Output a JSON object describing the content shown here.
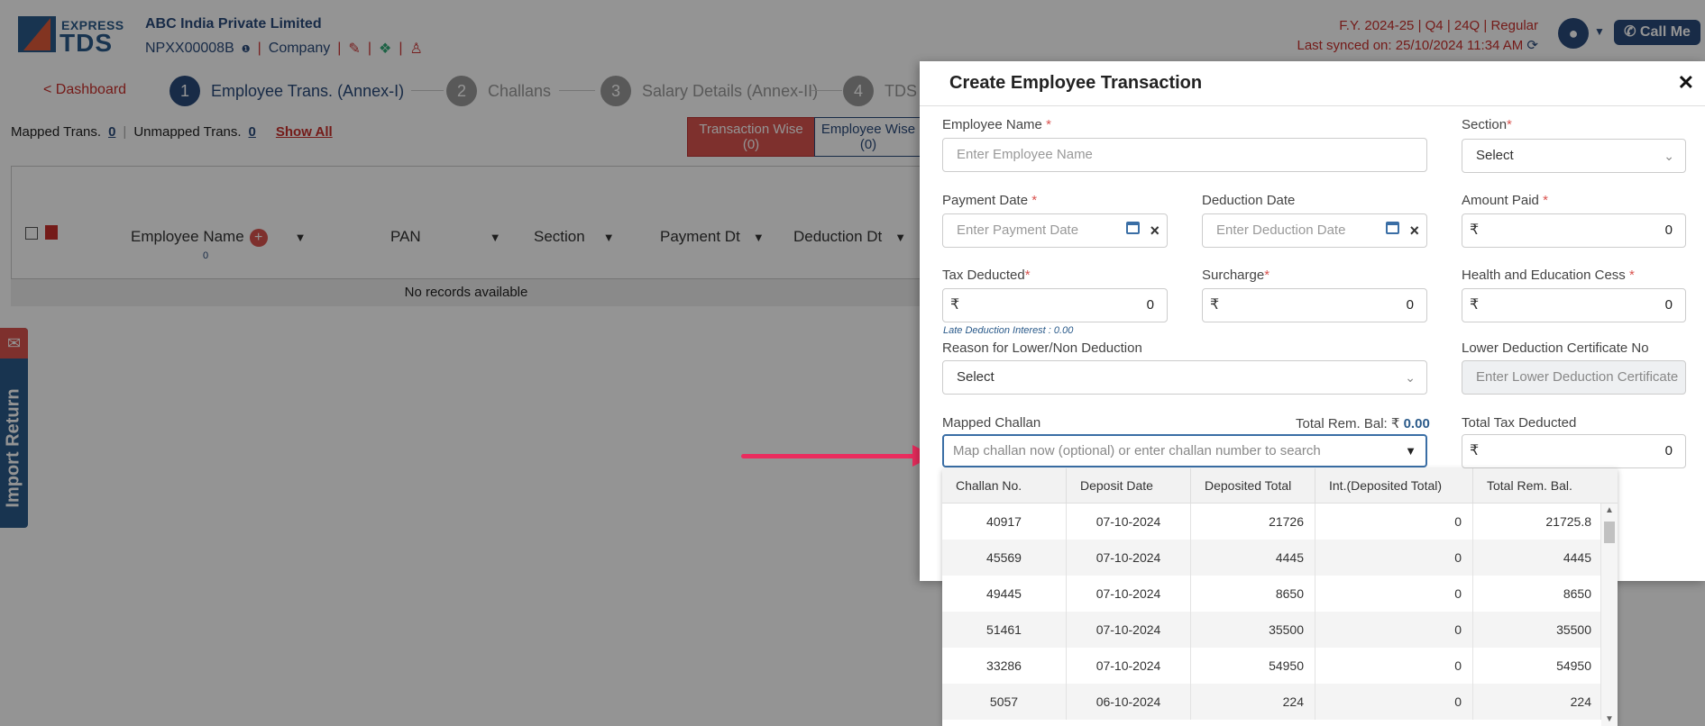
{
  "header": {
    "logo_top": "EXPRESS",
    "logo_bottom": "TDS",
    "company_name": "ABC India Private Limited",
    "tan": "NPXX00008B",
    "company_type": "Company",
    "fy_line": "F.Y. 2024-25  | Q4  | 24Q | Regular",
    "synced": "Last synced on: 25/10/2024 11:34 AM",
    "call_me": "Call Me"
  },
  "steps": {
    "back": "< Dashboard",
    "items": [
      {
        "num": "1",
        "label": "Employee Trans. (Annex-I)"
      },
      {
        "num": "2",
        "label": "Challans"
      },
      {
        "num": "3",
        "label": "Salary Details (Annex-II)"
      },
      {
        "num": "4",
        "label": "TDS"
      }
    ]
  },
  "toolbar": {
    "mapped_label": "Mapped Trans.",
    "mapped_count": "0",
    "unmapped_label": "Unmapped Trans.",
    "unmapped_count": "0",
    "show_all": "Show All",
    "transaction_wise": "Transaction Wise",
    "transaction_wise_count": "(0)",
    "employee_wise": "Employee Wise",
    "employee_wise_count": "(0)"
  },
  "grid": {
    "columns": [
      "Employee Name",
      "PAN",
      "Section",
      "Payment Dt",
      "Deduction Dt"
    ],
    "employee_count": "0",
    "empty": "No records available"
  },
  "side_tab": {
    "label": "Import Return"
  },
  "modal": {
    "title": "Create Employee Transaction",
    "employee_name": {
      "label": "Employee Name",
      "placeholder": "Enter Employee Name"
    },
    "section": {
      "label": "Section",
      "value": "Select"
    },
    "payment_date": {
      "label": "Payment Date",
      "placeholder": "Enter Payment Date"
    },
    "deduction_date": {
      "label": "Deduction Date",
      "placeholder": "Enter Deduction Date"
    },
    "amount_paid": {
      "label": "Amount Paid",
      "value": "0"
    },
    "tax_deducted": {
      "label": "Tax Deducted",
      "value": "0"
    },
    "surcharge": {
      "label": "Surcharge",
      "value": "0"
    },
    "cess": {
      "label": "Health and Education Cess",
      "value": "0"
    },
    "late_interest": "Late Deduction Interest : 0.00",
    "reason": {
      "label": "Reason for Lower/Non Deduction",
      "value": "Select"
    },
    "ldc": {
      "label": "Lower Deduction Certificate No",
      "placeholder": "Enter Lower Deduction Certificate"
    },
    "mapped_challan": {
      "label": "Mapped Challan",
      "placeholder": "Map challan now (optional) or enter challan number to search"
    },
    "total_rem_bal_label": "Total Rem. Bal: ₹",
    "total_rem_bal_value": "0.00",
    "total_tax": {
      "label": "Total Tax Deducted",
      "value": "0"
    },
    "currency": "₹"
  },
  "challan_dropdown": {
    "headers": [
      "Challan No.",
      "Deposit Date",
      "Deposited Total",
      "Int.(Deposited Total)",
      "Total Rem. Bal."
    ],
    "rows": [
      [
        "40917",
        "07-10-2024",
        "21726",
        "0",
        "21725.8"
      ],
      [
        "45569",
        "07-10-2024",
        "4445",
        "0",
        "4445"
      ],
      [
        "49445",
        "07-10-2024",
        "8650",
        "0",
        "8650"
      ],
      [
        "51461",
        "07-10-2024",
        "35500",
        "0",
        "35500"
      ],
      [
        "33286",
        "07-10-2024",
        "54950",
        "0",
        "54950"
      ],
      [
        "5057",
        "06-10-2024",
        "224",
        "0",
        "224"
      ]
    ]
  },
  "colors": {
    "brand": "#2a4a7a",
    "accent_red": "#d9534f",
    "arrow": "#ea2c5e"
  }
}
